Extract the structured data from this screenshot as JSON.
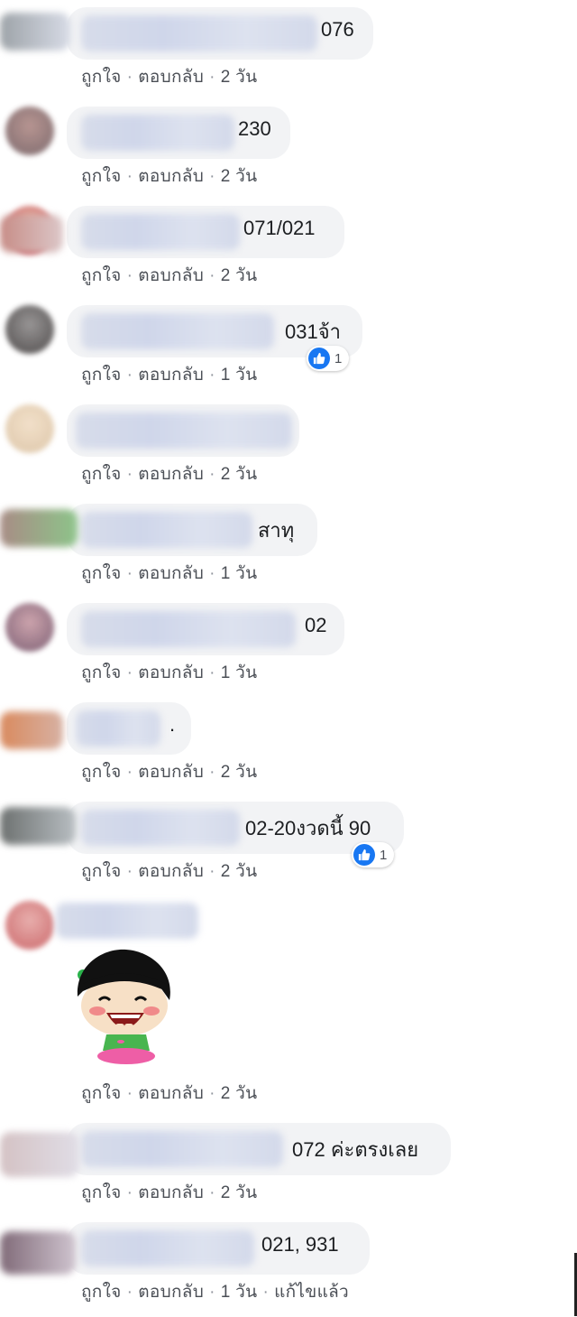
{
  "actions": {
    "like": "ถูกใจ",
    "reply": "ตอบกลับ",
    "separator": "·",
    "edited": "แก้ไขแล้ว"
  },
  "accent_color": "#1877f2",
  "comments": [
    {
      "text": "076",
      "time": "2 วัน"
    },
    {
      "text": "230",
      "time": "2 วัน"
    },
    {
      "text": "071/021",
      "time": "2 วัน"
    },
    {
      "text": "031จ้า",
      "time": "1 วัน",
      "reaction": {
        "icon": "thumbs-up-icon",
        "count": "1"
      }
    },
    {
      "text": "",
      "time": "2 วัน"
    },
    {
      "text": "สาทุ",
      "time": "1 วัน"
    },
    {
      "text": "02",
      "time": "1 วัน"
    },
    {
      "text": ".",
      "time": "2 วัน"
    },
    {
      "text": "02-20งวดนี้ 90",
      "time": "2 วัน",
      "reaction": {
        "icon": "thumbs-up-icon",
        "count": "1"
      }
    },
    {
      "text": "",
      "time": "2 วัน",
      "attachment": "laughing-girl-sticker"
    },
    {
      "text": "072 ค่ะตรงเลย",
      "time": "2 วัน"
    },
    {
      "text": "021, 931",
      "time": "1 วัน",
      "edited": true
    }
  ]
}
